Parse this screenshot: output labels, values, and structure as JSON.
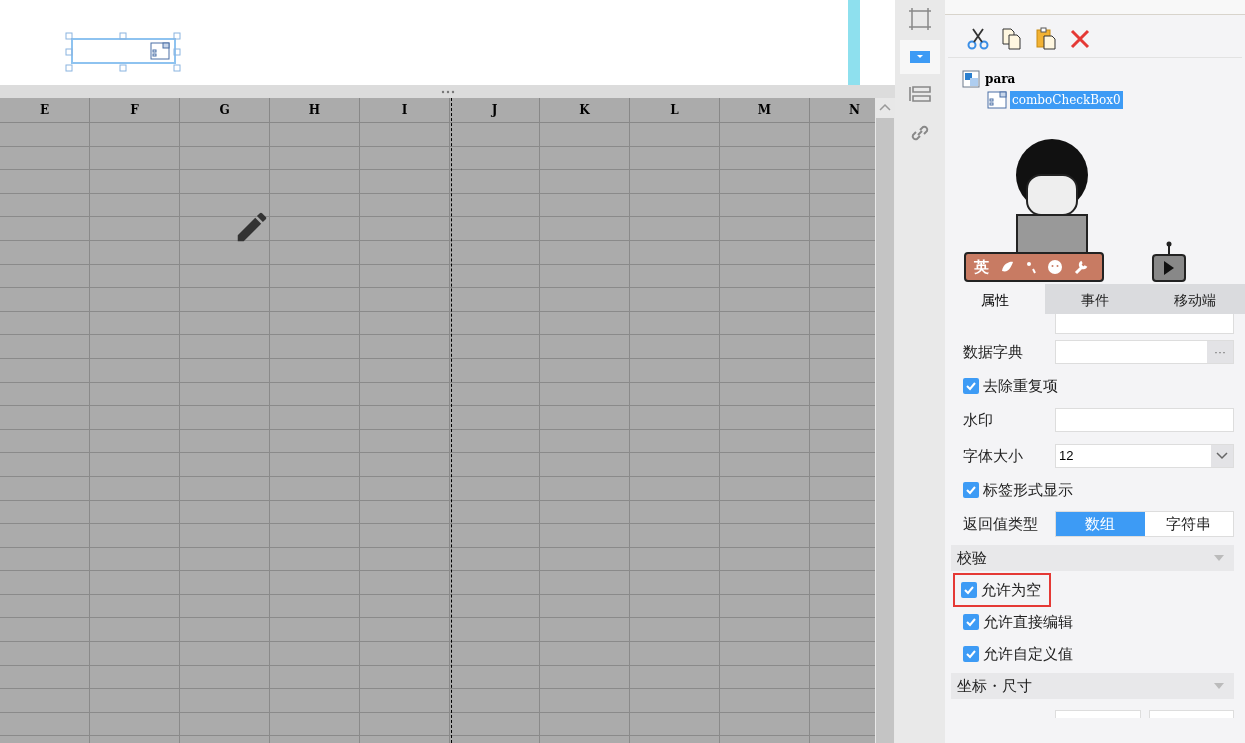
{
  "sheet": {
    "columns": [
      "E",
      "F",
      "G",
      "H",
      "I",
      "J",
      "K",
      "L",
      "M",
      "N"
    ]
  },
  "side_rail": {
    "items": [
      {
        "kind": "frame",
        "selected": false
      },
      {
        "kind": "combo",
        "selected": true
      },
      {
        "kind": "layers",
        "selected": false
      },
      {
        "kind": "link",
        "selected": false
      }
    ]
  },
  "widget_tree": {
    "toolbar": [
      {
        "kind": "cut"
      },
      {
        "kind": "copy"
      },
      {
        "kind": "paste"
      },
      {
        "kind": "delete"
      }
    ],
    "nodes": [
      {
        "label": "para",
        "selected": false,
        "children": [
          {
            "label": "comboCheckBox0",
            "selected": true
          }
        ]
      }
    ]
  },
  "ime_toolbar": {
    "label": "英"
  },
  "tabs": [
    {
      "label": "属性",
      "selected": true
    },
    {
      "label": "事件",
      "selected": false
    },
    {
      "label": "移动端",
      "selected": false
    }
  ],
  "properties": [
    {
      "kind": "field"
    },
    {
      "kind": "field",
      "label": "数据字典",
      "button": "···"
    },
    {
      "kind": "checkbox",
      "label": "去除重复项",
      "checked": true,
      "highlighted": false
    },
    {
      "kind": "field",
      "label": "水印"
    },
    {
      "kind": "select",
      "label": "字体大小",
      "value": "12"
    },
    {
      "kind": "checkbox",
      "label": "标签形式显示",
      "checked": true,
      "highlighted": false
    },
    {
      "kind": "segmented",
      "label": "返回值类型",
      "options": [
        {
          "label": "数组",
          "selected": true
        },
        {
          "label": "字符串",
          "selected": false
        }
      ]
    },
    {
      "kind": "section",
      "label": "校验"
    },
    {
      "kind": "checkbox",
      "label": "允许为空",
      "checked": true,
      "highlighted": true
    },
    {
      "kind": "checkbox",
      "label": "允许直接编辑",
      "checked": true,
      "highlighted": false
    },
    {
      "kind": "checkbox",
      "label": "允许自定义值",
      "checked": true,
      "highlighted": false
    },
    {
      "kind": "section",
      "label": "坐标・尺寸"
    },
    {
      "kind": "spinners"
    }
  ]
}
